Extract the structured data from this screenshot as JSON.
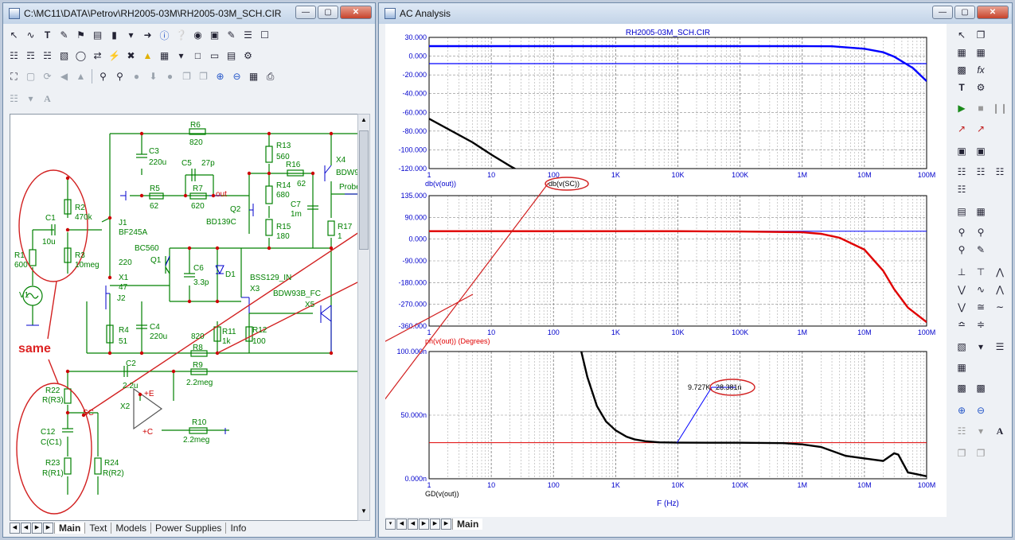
{
  "schematic_window": {
    "title": "C:\\MC11\\DATA\\Petrov\\RH2005-03M\\RH2005-03M_SCH.CIR",
    "tabs": [
      "Main",
      "Text",
      "Models",
      "Power Supplies",
      "Info"
    ],
    "annotation": "same",
    "toolbar_icons": [
      "select-arrow",
      "wire",
      "text-T",
      "pen",
      "flag",
      "bus",
      "component",
      "info",
      "help",
      "probe",
      "view",
      "edit",
      "list",
      "properties"
    ],
    "components": {
      "R6": "R6",
      "R6v": "820",
      "C3": "C3",
      "C3v": "220u",
      "C5": "C5",
      "C5v": "27p",
      "R5": "R5",
      "R5v": "62",
      "R7": "R7",
      "R7v": "620",
      "out": "out",
      "R13": "R13",
      "R13v": "560",
      "R16": "R16",
      "R16v": "62",
      "X4": "X4",
      "X4v": "BDW9",
      "Probe": "Probe",
      "R14": "R14",
      "R14v": "680",
      "C7": "C7",
      "C7v": "1m",
      "Q2": "Q2",
      "Q2v": "BD139C",
      "R15": "R15",
      "R15v": "180",
      "R17": "R17",
      "R17v": "1",
      "R2": "R2",
      "R2v": "470k",
      "C1": "C1",
      "C1v": "10u",
      "J1": "J1",
      "J1v": "BF245A",
      "R3": "R3",
      "R3v": "10meg",
      "R1": "R1",
      "R1v": "600",
      "BC560": "BC560",
      "Q1": "Q1",
      "v220": "220",
      "X1": "X1",
      "X1v": "47",
      "C6": "C6",
      "C6v": "3.3p",
      "D1": "D1",
      "BSS": "BSS129_IN",
      "X3": "X3",
      "V1": "V1",
      "J2": "J2",
      "BDW": "BDW93B_FC",
      "X5": "X5",
      "R4": "R4",
      "R4v": "51",
      "C4": "C4",
      "C4v": "220u",
      "R8v": "820",
      "R8": "R8",
      "R11": "R11",
      "R11v": "1k",
      "R12": "R12",
      "R12v": "100",
      "C2": "C2",
      "C2v": "2.2u",
      "R9": "R9",
      "R9v": "2.2meg",
      "R22": "R22",
      "R22v": "R(R3)",
      "SC": "SC",
      "X2": "X2",
      "VE": "+E",
      "VC": "+C",
      "R10": "R10",
      "R10v": "2.2meg",
      "C12": "C12",
      "C12v": "C(C1)",
      "R23": "R23",
      "R23v": "R(R1)",
      "R24": "R24",
      "R24v": "R(R2)"
    }
  },
  "analysis_window": {
    "title": "AC Analysis",
    "tabs": [
      "Main"
    ],
    "plot_title": "RH2005-03M_SCH.CIR",
    "xlabel": "F (Hz)",
    "x_ticks": [
      "1",
      "10",
      "100",
      "1K",
      "10K",
      "100K",
      "1M",
      "10M",
      "100M"
    ],
    "marker_label": "9.727K",
    "marker_value": "28.381n"
  },
  "colors": {
    "blue": "#0000ff",
    "red": "#e00000",
    "black": "#000000",
    "circuit": "#008000",
    "wire": "#0000cc",
    "annot": "#d22020"
  },
  "chart_data": [
    {
      "type": "line",
      "ylabel": "db(v(out))",
      "legend2": "db(v(SC))",
      "xscale": "log",
      "xlim": [
        1,
        100000000
      ],
      "ylim": [
        -120,
        30
      ],
      "y_ticks": [
        "30.000",
        "0.000",
        "-20.000",
        "-40.000",
        "-60.000",
        "-80.000",
        "-100.000",
        "-120.000"
      ],
      "series": [
        {
          "name": "db(v(out))",
          "color": "blue",
          "x": [
            1,
            10,
            100,
            1000,
            10000,
            100000,
            1000000,
            3000000,
            10000000,
            20000000,
            30000000,
            60000000,
            100000000
          ],
          "y": [
            20,
            20,
            20,
            20,
            20,
            20,
            20,
            19.8,
            17,
            13,
            8,
            -5,
            -20
          ]
        },
        {
          "name": "db(v(SC))",
          "color": "black",
          "x": [
            1,
            5,
            10,
            20,
            30
          ],
          "y": [
            -63,
            -90,
            -104,
            -117,
            -124
          ]
        }
      ]
    },
    {
      "type": "line",
      "ylabel": "ph(v(out)) (Degrees)",
      "xscale": "log",
      "xlim": [
        1,
        100000000
      ],
      "ylim": [
        -360,
        135
      ],
      "y_ticks": [
        "135.000",
        "90.000",
        "0.000",
        "-90.000",
        "-180.000",
        "-270.000",
        "-360.000"
      ],
      "series": [
        {
          "name": "ph(v(out))",
          "color": "red",
          "x": [
            1,
            10,
            100,
            1000,
            10000,
            100000,
            1000000,
            2000000,
            4000000,
            10000000,
            20000000,
            30000000,
            50000000,
            100000000
          ],
          "y": [
            0,
            0,
            0,
            0,
            0,
            -1,
            -4,
            -10,
            -25,
            -70,
            -150,
            -220,
            -290,
            -345
          ]
        }
      ]
    },
    {
      "type": "line",
      "ylabel": "GD(v(out))",
      "xscale": "log",
      "xlim": [
        1,
        100000000
      ],
      "ylim": [
        0,
        100
      ],
      "y_ticks": [
        "100.000n",
        "50.000n",
        "0.000n"
      ],
      "series": [
        {
          "name": "GD(v(out))",
          "color": "black",
          "x": [
            280,
            350,
            500,
            700,
            1000,
            1500,
            2000,
            3000,
            5000,
            10000,
            100000,
            500000,
            1000000,
            2000000,
            5000000,
            10000000,
            20000000,
            30000000,
            35000000,
            50000000,
            100000000
          ],
          "y": [
            100,
            80,
            57,
            45,
            38,
            33,
            31,
            29.5,
            28.6,
            28.4,
            28.3,
            28,
            27,
            25,
            18,
            16,
            14,
            20,
            19,
            5,
            2
          ]
        }
      ]
    }
  ]
}
